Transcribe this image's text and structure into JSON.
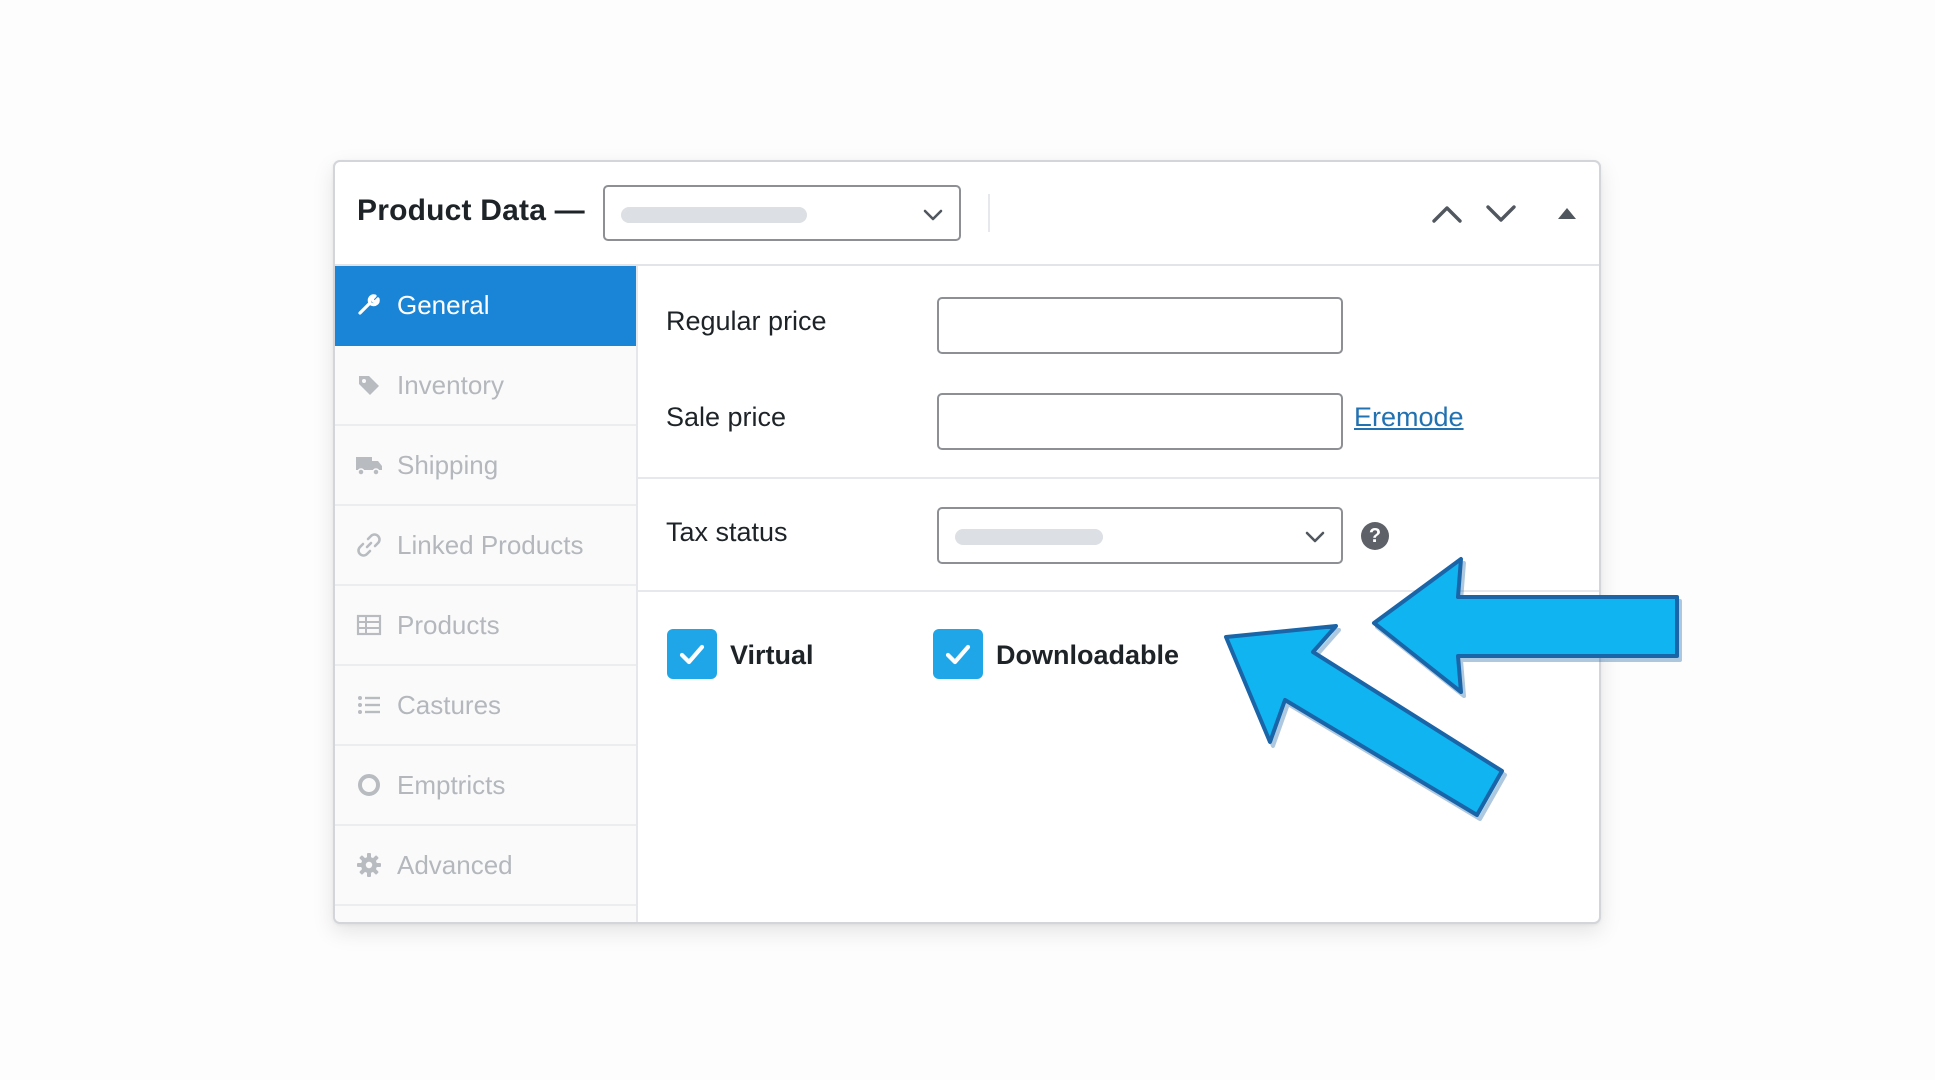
{
  "header": {
    "title": "Product Data —",
    "product_type_select": {
      "selected": ""
    },
    "buttons": [
      "move-up",
      "move-down",
      "toggle-panel"
    ]
  },
  "tabs": [
    {
      "label": "General",
      "icon": "wrench-icon",
      "active": true
    },
    {
      "label": "Inventory",
      "icon": "tag-icon",
      "active": false
    },
    {
      "label": "Shipping",
      "icon": "truck-icon",
      "active": false
    },
    {
      "label": "Linked Products",
      "icon": "link-icon",
      "active": false
    },
    {
      "label": "Products",
      "icon": "table-icon",
      "active": false
    },
    {
      "label": "Castures",
      "icon": "list-icon",
      "active": false
    },
    {
      "label": "Emptricts",
      "icon": "circle-icon",
      "active": false
    },
    {
      "label": "Advanced",
      "icon": "gear-icon",
      "active": false
    }
  ],
  "general": {
    "regular_price": {
      "label": "Regular price",
      "value": ""
    },
    "sale_price": {
      "label": "Sale price",
      "value": "",
      "link": "Eremode"
    },
    "tax_status": {
      "label": "Tax status",
      "selected": ""
    },
    "virtual": {
      "label": "Virtual",
      "checked": true
    },
    "downloadable": {
      "label": "Downloadable",
      "checked": true
    }
  },
  "colors": {
    "active_tab": "#1a85d6",
    "checkbox": "#1fa6e8",
    "link": "#2271b1",
    "annotation_arrow": "#10b4f0",
    "annotation_arrow_outline": "#1a64a8"
  }
}
